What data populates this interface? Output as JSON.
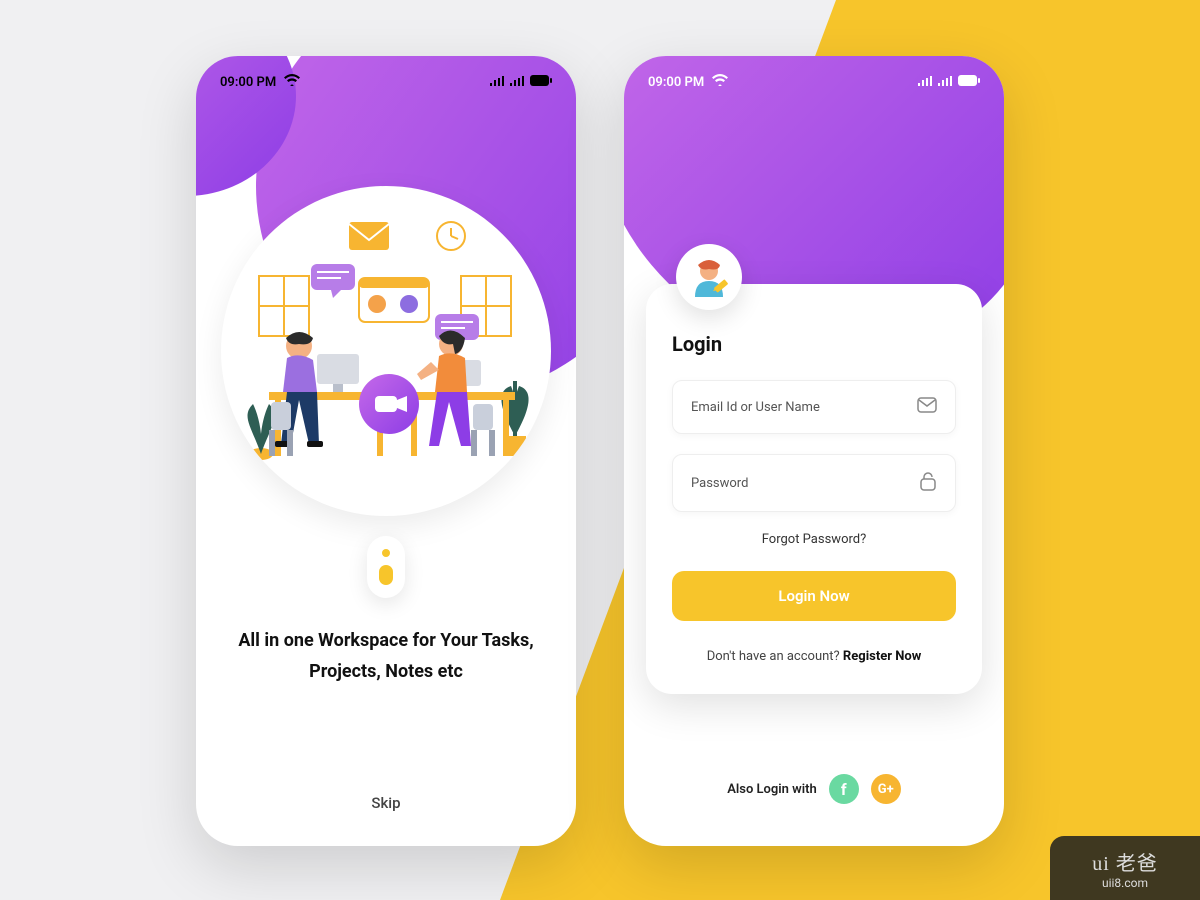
{
  "status": {
    "time": "09:00 PM"
  },
  "onboarding": {
    "headline": "All in one Workspace for Your Tasks, Projects, Notes etc",
    "skip_label": "Skip"
  },
  "login": {
    "title": "Login",
    "email_placeholder": "Email Id or User Name",
    "password_placeholder": "Password",
    "forgot_label": "Forgot Password?",
    "login_button": "Login Now",
    "register_prompt": "Don't have an account? ",
    "register_action": "Register Now",
    "also_login_label": "Also Login with",
    "facebook_glyph": "f",
    "google_glyph": "G+"
  },
  "watermark": {
    "brand": "ui 老爸",
    "url": "uii8.com"
  },
  "colors": {
    "yellow": "#f7c52b",
    "purple_light": "#c569e8",
    "purple_dark": "#8d3de6",
    "green": "#6ad9a1"
  }
}
